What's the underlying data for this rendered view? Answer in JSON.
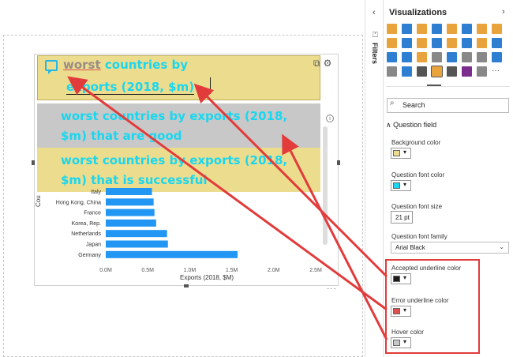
{
  "qna": {
    "question_word1": "worst",
    "question_line1_rest": "countries by",
    "question_line2": "exports (2018, $m)",
    "suggestions": [
      "worst countries by exports (2018, $m) that are good",
      "worst countries by exports (2018, $m) that is successful"
    ]
  },
  "chart_data": {
    "type": "bar",
    "orientation": "horizontal",
    "categories": [
      "Italy",
      "Hong Kong, China",
      "France",
      "Korea, Rep.",
      "Netherlands",
      "Japan",
      "Germany"
    ],
    "values": [
      0.55,
      0.57,
      0.58,
      0.6,
      0.73,
      0.74,
      1.57
    ],
    "xlabel": "Exports (2018, $M)",
    "ylabel": "Cou",
    "xlim": [
      0,
      2.5
    ],
    "xticks": [
      "0.0M",
      "0.5M",
      "1.0M",
      "1.5M",
      "2.0M",
      "2.5M"
    ],
    "bar_color": "#2196f3"
  },
  "canvas": {
    "more_label": "···",
    "info_label": "i"
  },
  "pane": {
    "filters_label": "Filters",
    "title": "Visualizations",
    "search_placeholder": "Search",
    "section": "Question field",
    "background_color_label": "Background color",
    "question_font_color_label": "Question font color",
    "question_font_size_label": "Question font size",
    "font_size_value": "21",
    "font_size_unit": "pt",
    "question_font_family_label": "Question font family",
    "font_family_value": "Arial Black",
    "accepted_underline_label": "Accepted underline color",
    "error_underline_label": "Error underline color",
    "hover_color_label": "Hover color",
    "more_visuals": "···",
    "colors": {
      "background": "#ecdc8e",
      "question_font": "#19d7f0",
      "accepted_underline": "#1a1a1a",
      "error_underline": "#e05050",
      "hover": "#c8c8c8",
      "highlight_frame": "#e23b3b"
    }
  }
}
